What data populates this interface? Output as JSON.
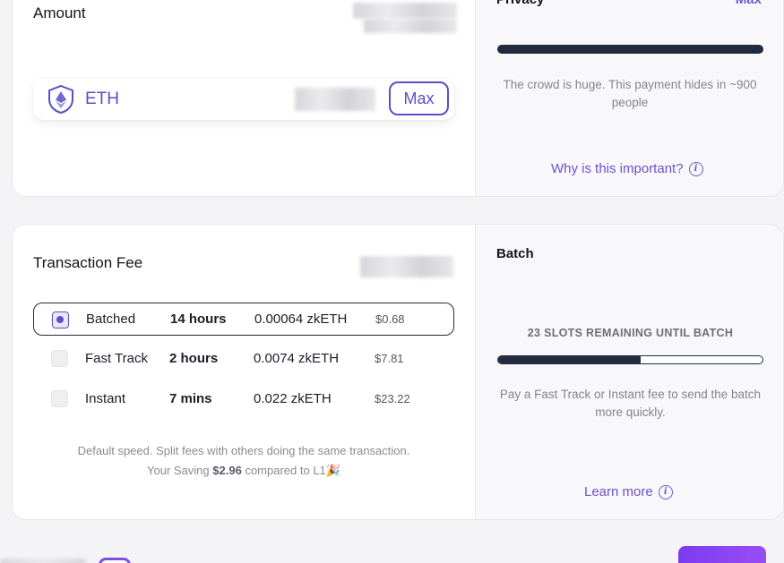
{
  "amount": {
    "label": "Amount",
    "token": {
      "name": "ETH",
      "icon": "eth-shield-icon"
    },
    "max_label": "Max"
  },
  "privacy": {
    "title": "Privacy",
    "level": "Max",
    "level_fraction": 1.0,
    "description": "The crowd is huge. This payment hides in ~900 people",
    "link": "Why is this important?"
  },
  "fee": {
    "title": "Transaction Fee",
    "options": [
      {
        "name": "Batched",
        "time": "14 hours",
        "amount": "0.00064 zkETH",
        "usd": "$0.68",
        "selected": true
      },
      {
        "name": "Fast Track",
        "time": "2 hours",
        "amount": "0.0074 zkETH",
        "usd": "$7.81",
        "selected": false
      },
      {
        "name": "Instant",
        "time": "7 mins",
        "amount": "0.022 zkETH",
        "usd": "$23.22",
        "selected": false
      }
    ],
    "note_line1": "Default speed. Split fees with others doing the same transaction.",
    "note_saving_prefix": "Your Saving",
    "note_saving_value": "$2.96",
    "note_saving_suffix": "compared to L1",
    "note_emoji": "🎉"
  },
  "batch": {
    "title": "Batch",
    "slots_label": "23 SLOTS REMAINING UNTIL BATCH",
    "fill_fraction": 0.54,
    "description": "Pay a Fast Track or Instant fee to send the batch more quickly.",
    "link": "Learn more"
  },
  "colors": {
    "accent": "#5b4ec9",
    "link": "#6d4fd1",
    "bar": "#222a3d",
    "button_gradient_start": "#7b3cf0"
  }
}
